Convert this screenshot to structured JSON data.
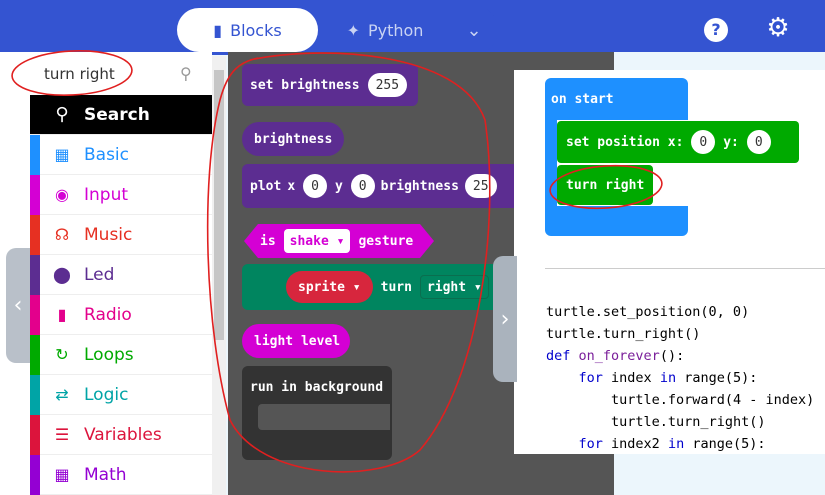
{
  "header": {
    "tabs": [
      {
        "label": "Blocks",
        "icon": "puzzle-icon",
        "active": true
      },
      {
        "label": "Python",
        "icon": "python-icon",
        "active": false
      }
    ],
    "more_icon": "chevron-down-icon",
    "help_icon": "help-icon",
    "settings_icon": "gear-icon"
  },
  "toolbox": {
    "search": {
      "value": "turn right",
      "icon": "search-icon"
    },
    "categories": [
      {
        "label": "Search",
        "icon": "search-icon",
        "color": "#000000"
      },
      {
        "label": "Basic",
        "icon": "grid-icon",
        "color": "#1e90ff"
      },
      {
        "label": "Input",
        "icon": "target-icon",
        "color": "#d400d4"
      },
      {
        "label": "Music",
        "icon": "headphones-icon",
        "color": "#e63022"
      },
      {
        "label": "Led",
        "icon": "toggle-icon",
        "color": "#5c2d91"
      },
      {
        "label": "Radio",
        "icon": "signal-bars-icon",
        "color": "#e3008c"
      },
      {
        "label": "Loops",
        "icon": "loop-arrow-icon",
        "color": "#00aa00"
      },
      {
        "label": "Logic",
        "icon": "shuffle-icon",
        "color": "#00a4a6"
      },
      {
        "label": "Variables",
        "icon": "list-icon",
        "color": "#dc143c"
      },
      {
        "label": "Math",
        "icon": "calculator-icon",
        "color": "#9400d3"
      }
    ]
  },
  "flyout": {
    "set_brightness": {
      "label": "set brightness",
      "value": "255"
    },
    "brightness": {
      "label": "brightness"
    },
    "plot": {
      "plot": "plot",
      "x": "x",
      "x_value": "0",
      "y": "y",
      "y_value": "0",
      "brightness": "brightness",
      "b_value": "25"
    },
    "is_gesture": {
      "is": "is",
      "option": "shake",
      "gesture": "gesture"
    },
    "turn": {
      "sprite": "sprite",
      "turn": "turn",
      "direction": "right"
    },
    "light_level": {
      "label": "light level"
    },
    "run_in_background": {
      "label": "run in background"
    }
  },
  "workspace": {
    "on_start": "on start",
    "set_position": {
      "label": "set position x:",
      "x": "0",
      "y_label": "y:",
      "y": "0"
    },
    "turn_right": "turn right"
  },
  "code": {
    "line1": "turtle.set_position(0, 0)",
    "line2": "turtle.turn_right()",
    "line3_kw": "def",
    "line3_fn": "on_forever",
    "line3_rest": "():",
    "line4_kw": "for",
    "line4_var": "index",
    "line4_kw2": "in",
    "line4_rest": "range(5):",
    "line5": "turtle.forward(4 - index)",
    "line6": "turtle.turn_right()",
    "line7_kw": "for",
    "line7_var": "index2",
    "line7_kw2": "in",
    "line7_rest": "range(5):"
  }
}
